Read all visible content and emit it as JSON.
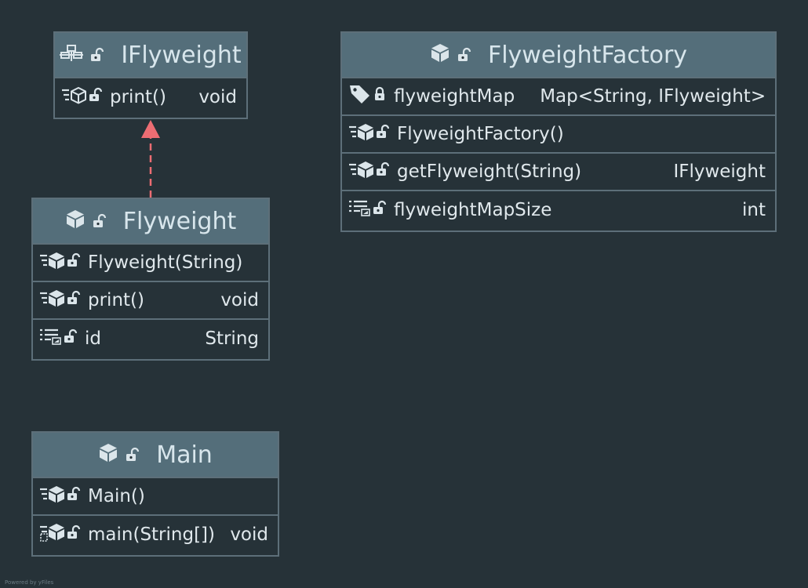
{
  "diagram": {
    "type": "uml-class-diagram",
    "colors": {
      "background": "#263238",
      "header": "#546e7a",
      "border": "#5d6f79",
      "text": "#e0e8ec",
      "icon": "#dbe5ea",
      "realization_arrow": "#ec6d73"
    },
    "classes": {
      "iflyweight": {
        "title": "IFlyweight",
        "kind_icon": "interface-icon",
        "visibility_icon": "unlocked-icon",
        "members": [
          {
            "name": "print()",
            "type": "void",
            "icon": "abstract-method-icon",
            "visibility_icon": "unlocked-icon"
          }
        ]
      },
      "flyweight": {
        "title": "Flyweight",
        "kind_icon": "class-icon",
        "visibility_icon": "unlocked-icon",
        "members": [
          {
            "name": "Flyweight(String)",
            "type": "",
            "icon": "method-icon",
            "visibility_icon": "unlocked-icon"
          },
          {
            "name": "print()",
            "type": "void",
            "icon": "method-icon",
            "visibility_icon": "unlocked-icon"
          },
          {
            "name": "id",
            "type": "String",
            "icon": "property-icon",
            "visibility_icon": "unlocked-icon"
          }
        ]
      },
      "flyweightfactory": {
        "title": "FlyweightFactory",
        "kind_icon": "class-icon",
        "visibility_icon": "unlocked-icon",
        "members": [
          {
            "name": "flyweightMap",
            "type": "Map<String, IFlyweight>",
            "icon": "field-tag-icon",
            "visibility_icon": "locked-icon"
          },
          {
            "name": "FlyweightFactory()",
            "type": "",
            "icon": "method-icon",
            "visibility_icon": "unlocked-icon"
          },
          {
            "name": "getFlyweight(String)",
            "type": "IFlyweight",
            "icon": "method-icon",
            "visibility_icon": "unlocked-icon"
          },
          {
            "name": "flyweightMapSize",
            "type": "int",
            "icon": "property-icon",
            "visibility_icon": "unlocked-icon"
          }
        ]
      },
      "main": {
        "title": "Main",
        "kind_icon": "class-icon",
        "visibility_icon": "unlocked-icon",
        "members": [
          {
            "name": "Main()",
            "type": "",
            "icon": "method-icon",
            "visibility_icon": "unlocked-icon"
          },
          {
            "name": "main(String[])",
            "type": "void",
            "icon": "static-method-icon",
            "visibility_icon": "unlocked-icon"
          }
        ]
      }
    },
    "relations": [
      {
        "from": "Flyweight",
        "to": "IFlyweight",
        "kind": "realization",
        "style": "dashed-hollow-arrow"
      }
    ]
  },
  "footer": {
    "credit": "Powered by yFiles"
  }
}
